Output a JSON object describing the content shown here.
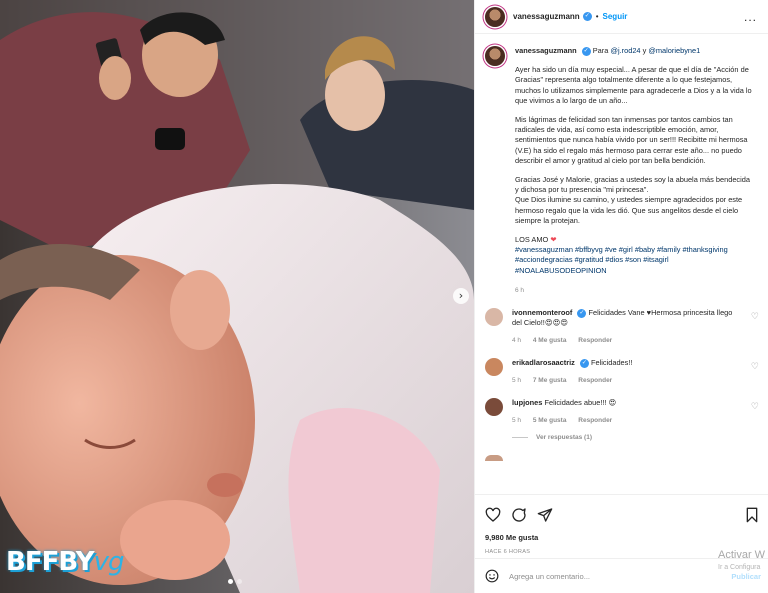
{
  "post": {
    "watermark_main": "BFFBY",
    "watermark_tail": "vg",
    "carousel_next_icon": "chevron-right-icon"
  },
  "header": {
    "username": "vanessaguzmann",
    "separator": "•",
    "follow_label": "Seguir",
    "more_label": "..."
  },
  "caption": {
    "username": "vanessaguzmann",
    "para_prefix": "Para",
    "tag1": "@j.rod24",
    "and": "y",
    "tag2": "@maloriebyne1",
    "paragraph1": "Ayer ha sido un día muy especial... A pesar de que el día de \"Acción de Gracias\" representa algo totalmente diferente a lo que festejamos, muchos lo utilizamos simplemente para agradecerle a Dios y a la vida lo que vivimos a lo largo de un año...",
    "paragraph2": "Mis lágrimas de felicidad son tan inmensas por tantos cambios tan radicales de vida, así como esta indescriptible emoción, amor, sentimientos que nunca había vivido por un ser!!! Recibitte mi hermosa (V.E) ha sido el regalo más hermoso para cerrar este año... no puedo describir el amor y gratitud al cielo por tan bella bendición.",
    "paragraph3a": "Gracias José y Malorie, gracias a ustedes soy la abuela más bendecida y dichosa por tu presencia \"mi princesa\".",
    "paragraph3b": "Que Dios ilumine su camino, y ustedes siempre agradecidos por este hermoso regalo que la vida les dió. Que sus angelitos desde el cielo siempre la protejan.",
    "closing": "LOS AMO",
    "hashtags": "#vanessaguzman #bffbyvg #ve #girl #baby #family #thanksgiving #acciondegracias #gratitud #dios #son #itsagirl #NOALABUSODEOPINION",
    "time": "6 h"
  },
  "comments": [
    {
      "username": "ivonnemonteroof",
      "text": "Felicidades Vane ♥Hermosa princesita llego del Cielo!!😍😍😍",
      "time": "4 h",
      "likes": "4 Me gusta",
      "reply": "Responder",
      "avatar_color": "#d9b7a6"
    },
    {
      "username": "erikadlarosaactriz",
      "text": "Felicidades!!",
      "time": "5 h",
      "likes": "7 Me gusta",
      "reply": "Responder",
      "avatar_color": "#c9875f"
    },
    {
      "username": "lupjones",
      "text": "Felicidades abue!!! 😍",
      "time": "5 h",
      "likes": "5 Me gusta",
      "reply": "Responder",
      "avatar_color": "#7a4b3a"
    }
  ],
  "view_replies": "Ver respuestas (1)",
  "actions": {
    "like_icon": "heart-icon",
    "comment_icon": "comment-icon",
    "share_icon": "share-icon",
    "save_icon": "bookmark-icon",
    "likes_count": "9,980 Me gusta",
    "posted_ago": "HACE 6 HORAS"
  },
  "add_comment": {
    "emoji_icon": "smiley-icon",
    "placeholder": "Agrega un comentario...",
    "publish_label": "Publicar"
  },
  "os_overlay": {
    "title": "Activar W",
    "subtitle": "Ir a Configura"
  },
  "colors": {
    "link": "#00376b",
    "follow": "#0095f6",
    "verified": "#3897f0",
    "heart": "#ed4956",
    "muted": "#8e8e8e"
  }
}
